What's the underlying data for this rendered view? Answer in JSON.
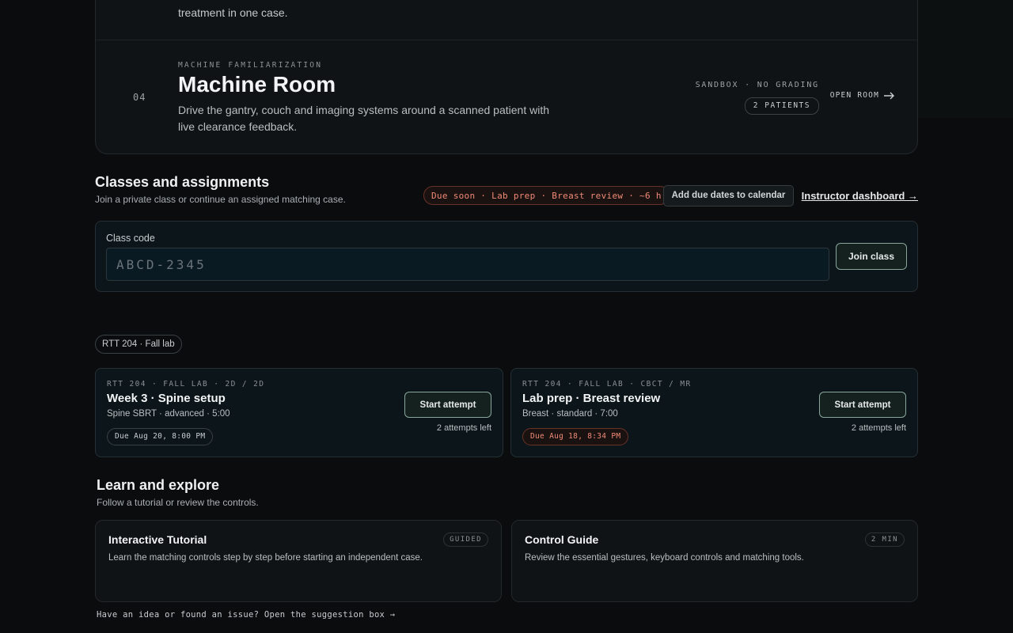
{
  "modes": {
    "previous_desc_tail": "treatment in one case.",
    "machine_room": {
      "number": "04",
      "eyebrow": "MACHINE FAMILIARIZATION",
      "title": "Machine Room",
      "description": "Drive the gantry, couch and imaging systems around a scanned patient with live clearance feedback.",
      "meta": "SANDBOX · NO GRADING",
      "patients": "2 PATIENTS",
      "open_label": "OPEN ROOM"
    }
  },
  "classes": {
    "title": "Classes and assignments",
    "subtitle": "Join a private class or continue an assigned matching case.",
    "due_soon": "Due soon · Lab prep · Breast review · ~6 h",
    "calendar_button": "Add due dates to calendar",
    "instructor_link": "Instructor dashboard →",
    "code_label": "Class code",
    "code_placeholder": "ABCD-2345",
    "join_button": "Join class",
    "group_chip": "RTT 204 · Fall lab",
    "assignments": [
      {
        "eyebrow": "RTT 204 · FALL LAB · 2D / 2D",
        "title": "Week 3 · Spine setup",
        "meta": "Spine SBRT · advanced · 5:00",
        "due": "Due Aug 20, 8:00 PM",
        "button": "Start attempt",
        "attempts": "2 attempts left"
      },
      {
        "eyebrow": "RTT 204 · FALL LAB · CBCT / MR",
        "title": "Lab prep · Breast review",
        "meta": "Breast · standard · 7:00",
        "due": "Due Aug 18, 8:34 PM",
        "button": "Start attempt",
        "attempts": "2 attempts left"
      }
    ]
  },
  "learn": {
    "title": "Learn and explore",
    "subtitle": "Follow a tutorial or review the controls.",
    "cards": [
      {
        "title": "Interactive Tutorial",
        "badge": "GUIDED",
        "description": "Learn the matching controls step by step before starting an independent case."
      },
      {
        "title": "Control Guide",
        "badge": "2 MIN",
        "description": "Review the essential gestures, keyboard controls and matching tools."
      }
    ]
  },
  "footer": {
    "suggestion": "Have an idea or found an issue? Open the suggestion box →"
  },
  "colors": {
    "background": "#0a0c0d",
    "urgent": "#f08a76",
    "accent_border": "#8aa69b"
  },
  "icons": {
    "open_room": "arrow-right-icon"
  }
}
